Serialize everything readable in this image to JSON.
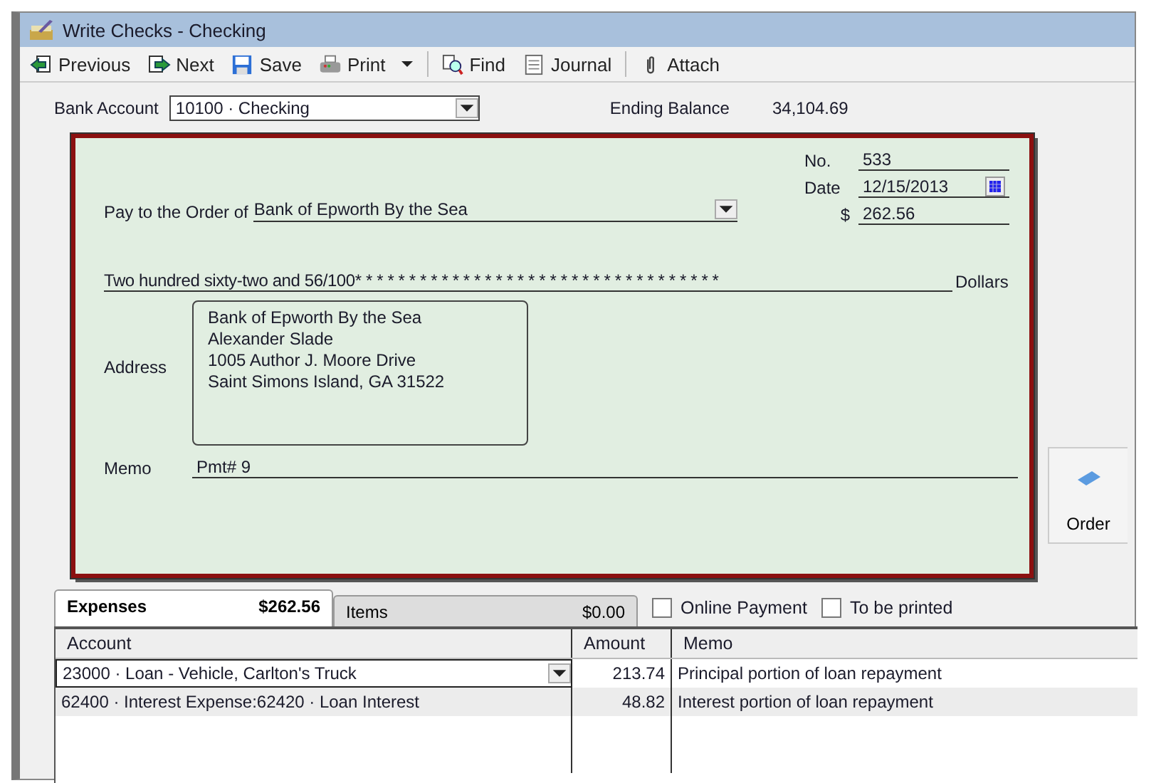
{
  "window": {
    "title": "Write Checks - Checking"
  },
  "toolbar": [
    {
      "label": "Previous"
    },
    {
      "label": "Next"
    },
    {
      "label": "Save"
    },
    {
      "label": "Print"
    },
    {
      "label": "Find"
    },
    {
      "label": "Journal"
    },
    {
      "label": "Attach"
    }
  ],
  "bank_account": {
    "label": "Bank Account",
    "value": "10100 · Checking",
    "balance_label": "Ending Balance",
    "balance": "34,104.69"
  },
  "check": {
    "no_label": "No.",
    "no": "533",
    "date_label": "Date",
    "date": "12/15/2013",
    "amount_label": "$",
    "amount": "262.56",
    "payee_label": "Pay to the Order of",
    "payee": "Bank of Epworth By the Sea",
    "amount_words": "Two hundred sixty-two and 56/100* * * * * * * * * * * * * * * * * * * * * * * * * * * * * * * * * *",
    "dollars": "Dollars",
    "address_label": "Address",
    "address": [
      "Bank of Epworth By the Sea",
      "Alexander Slade",
      "1005 Author J. Moore Drive",
      "Saint Simons Island, GA 31522"
    ],
    "memo_label": "Memo",
    "memo": "Pmt# 9"
  },
  "order_button": {
    "label": "Order"
  },
  "tabs": [
    {
      "label": "Expenses",
      "amount": "$262.56",
      "selected": true
    },
    {
      "label": "Items",
      "amount": "$0.00",
      "selected": false
    }
  ],
  "options": [
    {
      "label": "Online Payment",
      "checked": false
    },
    {
      "label": "To be printed",
      "checked": false
    }
  ],
  "table": {
    "columns": [
      "Account",
      "Amount",
      "Memo"
    ],
    "rows": [
      {
        "account": "23000 · Loan - Vehicle, Carlton's Truck",
        "amount": "213.74",
        "memo": "Principal portion of loan repayment"
      },
      {
        "account": "62400 · Interest Expense:62420 · Loan Interest",
        "amount": "48.82",
        "memo": "Interest portion of loan repayment"
      }
    ]
  }
}
